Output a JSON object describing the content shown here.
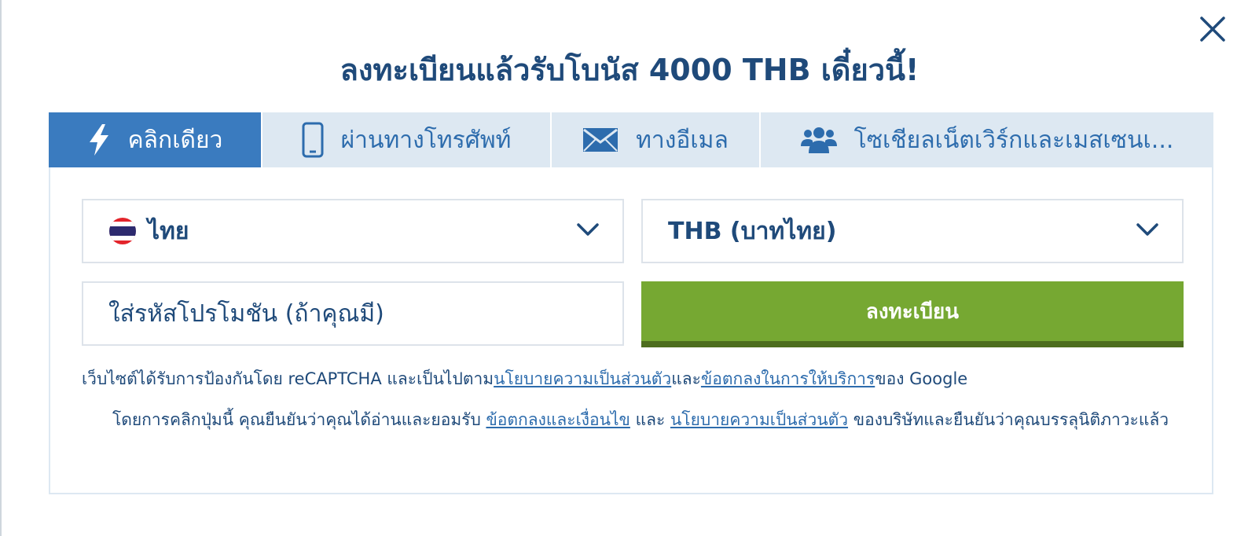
{
  "title": "ลงทะเบียนแล้วรับโบนัส 4000 THB เดี๋ยวนี้!",
  "tabs": [
    {
      "label": "คลิกเดียว",
      "icon": "lightning-icon",
      "active": true
    },
    {
      "label": "ผ่านทางโทรศัพท์",
      "icon": "phone-icon",
      "active": false
    },
    {
      "label": "ทางอีเมล",
      "icon": "envelope-icon",
      "active": false
    },
    {
      "label": "โซเชียลเน็ตเวิร์กและเมสเซนเ...",
      "icon": "users-icon",
      "active": false
    }
  ],
  "country_select": {
    "value": "ไทย",
    "icon": "thailand-flag-icon"
  },
  "currency_select": {
    "value": "THB (บาทไทย)"
  },
  "promo": {
    "placeholder": "ใส่รหัสโปรโมชัน (ถ้าคุณมี)"
  },
  "register_button": {
    "label": "ลงทะเบียน"
  },
  "recaptcha": {
    "prefix": "เว็บไซต์ได้รับการป้องกันโดย reCAPTCHA และเป็นไปตาม",
    "privacy_link": "นโยบายความเป็นส่วนตัว",
    "middle": "และ",
    "terms_link": "ข้อตกลงในการให้บริการ",
    "suffix": "ของ Google"
  },
  "terms": {
    "prefix": "โดยการคลิกปุ่มนี้ คุณยืนยันว่าคุณได้อ่านและยอมรับ ",
    "conditions_link": "ข้อตกลงและเงื่อนไข",
    "middle": " และ ",
    "privacy_link": "นโยบายความเป็นส่วนตัว",
    "suffix": " ของบริษัทและยืนยันว่าคุณบรรลุนิติภาวะแล้ว"
  },
  "colors": {
    "primary_text": "#1f4a7a",
    "tab_active_bg": "#3a7bbf",
    "tab_bg": "#dde8f2",
    "register_green": "#76a832",
    "link": "#2d6cad"
  }
}
